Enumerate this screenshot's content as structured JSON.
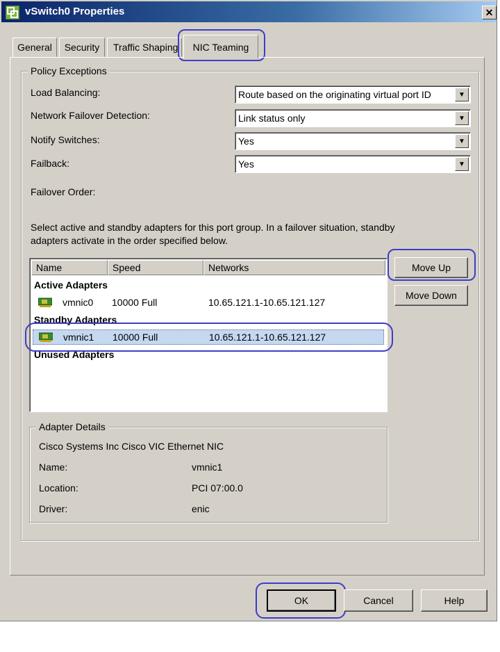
{
  "window": {
    "title": "vSwitch0 Properties",
    "close_glyph": "✕"
  },
  "tabs": [
    {
      "label": "General"
    },
    {
      "label": "Security"
    },
    {
      "label": "Traffic Shaping"
    },
    {
      "label": "NIC Teaming",
      "active": true
    }
  ],
  "policy": {
    "legend": "Policy Exceptions",
    "load_balancing": {
      "label": "Load Balancing:",
      "value": "Route based on the originating virtual port ID"
    },
    "failover_detection": {
      "label": "Network Failover Detection:",
      "value": "Link status only"
    },
    "notify_switches": {
      "label": "Notify Switches:",
      "value": "Yes"
    },
    "failback": {
      "label": "Failback:",
      "value": "Yes"
    },
    "failover_order_label": "Failover Order:",
    "description_line1": "Select active and standby adapters for this port group.  In a failover situation, standby",
    "description_line2": "adapters activate  in the order specified below."
  },
  "adapters": {
    "columns": [
      "Name",
      "Speed",
      "Networks"
    ],
    "active_heading": "Active Adapters",
    "standby_heading": "Standby Adapters",
    "unused_heading": "Unused Adapters",
    "active": [
      {
        "name": "vmnic0",
        "speed": "10000 Full",
        "networks": "10.65.121.1-10.65.121.127"
      }
    ],
    "standby": [
      {
        "name": "vmnic1",
        "speed": "10000 Full",
        "networks": "10.65.121.1-10.65.121.127"
      }
    ]
  },
  "buttons": {
    "move_up": "Move Up",
    "move_down": "Move Down",
    "ok": "OK",
    "cancel": "Cancel",
    "help": "Help"
  },
  "details": {
    "legend": "Adapter Details",
    "description": "Cisco Systems Inc Cisco VIC Ethernet NIC",
    "name_label": "Name:",
    "name_value": "vmnic1",
    "location_label": "Location:",
    "location_value": "PCI 07:00.0",
    "driver_label": "Driver:",
    "driver_value": "enic"
  },
  "colors": {
    "title_bar": "#0a246a",
    "selection": "#c6d8f0",
    "annotation": "#3d3dc8",
    "dialog": "#d4d0c8"
  }
}
